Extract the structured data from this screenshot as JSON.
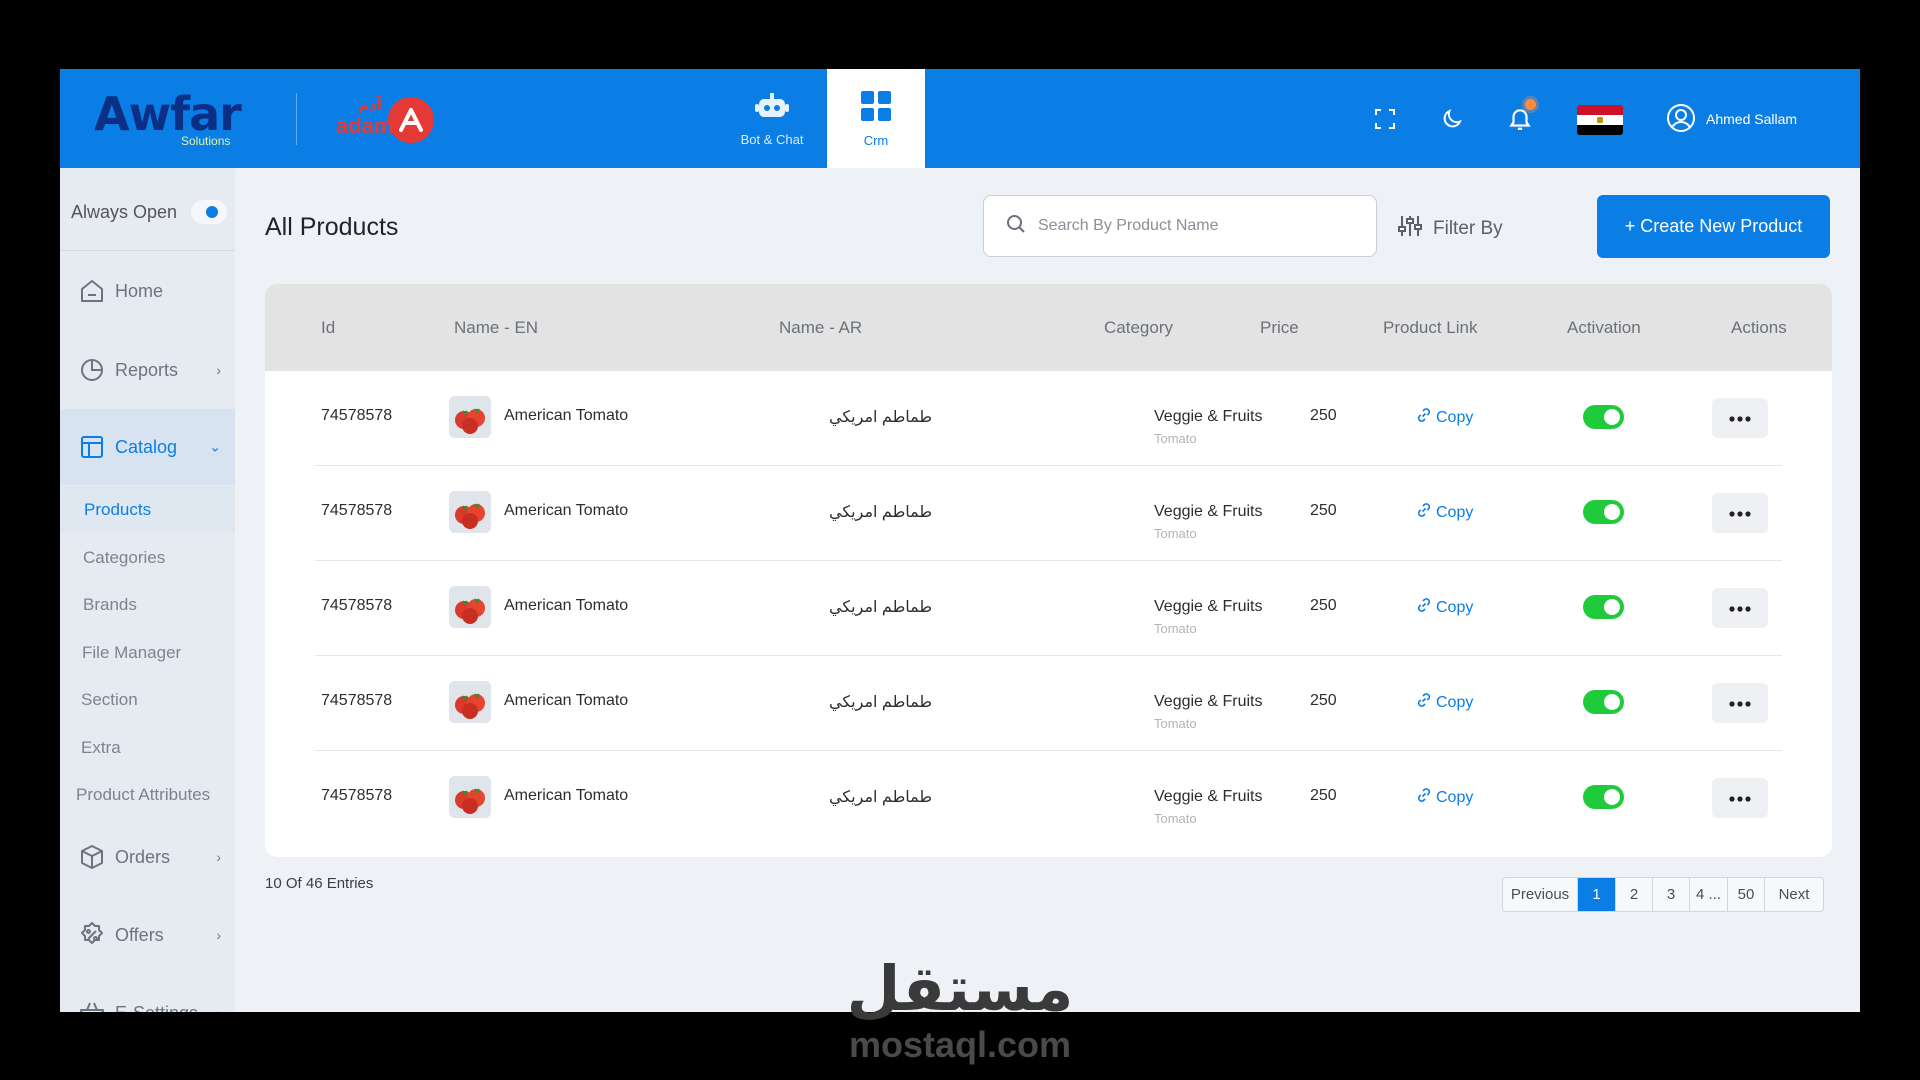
{
  "header": {
    "brand_name": "Awfar",
    "brand_sub": "Solutions",
    "partner_ar": "آدم",
    "partner_en": "adam",
    "tabs": [
      {
        "label": "Bot & Chat",
        "icon": "robot-icon"
      },
      {
        "label": "Crm",
        "icon": "grid-icon",
        "active": true
      }
    ],
    "user_name": "Ahmed Sallam",
    "accent": "#0b7ee6"
  },
  "sidebar": {
    "always_open_label": "Always Open",
    "items": [
      {
        "label": "Home",
        "icon": "home-icon"
      },
      {
        "label": "Reports",
        "icon": "pie-chart-icon"
      },
      {
        "label": "Catalog",
        "icon": "layout-icon",
        "active": true
      },
      {
        "label": "Orders",
        "icon": "box-icon"
      },
      {
        "label": "Offers",
        "icon": "discount-icon"
      },
      {
        "label": "E-Settings",
        "icon": "basket-icon"
      }
    ],
    "catalog_sub": [
      "Products",
      "Categories",
      "Brands",
      "File Manager",
      "Section",
      "Extra",
      "Product Attributes"
    ]
  },
  "main": {
    "title": "All Products",
    "search_placeholder": "Search By Product Name",
    "filter_label": "Filter By",
    "create_label": "+ Create New Product",
    "columns": [
      "Id",
      "Name - EN",
      "Name - AR",
      "Category",
      "Price",
      "Product Link",
      "Activation",
      "Actions"
    ],
    "rows": [
      {
        "id": "74578578",
        "name_en": "American Tomato",
        "name_ar": "طماطم امريكي",
        "category": "Veggie & Fruits",
        "subcategory": "Tomato",
        "price": "250",
        "link_label": "Copy",
        "active": true
      },
      {
        "id": "74578578",
        "name_en": "American Tomato",
        "name_ar": "طماطم امريكي",
        "category": "Veggie & Fruits",
        "subcategory": "Tomato",
        "price": "250",
        "link_label": "Copy",
        "active": true
      },
      {
        "id": "74578578",
        "name_en": "American Tomato",
        "name_ar": "طماطم امريكي",
        "category": "Veggie & Fruits",
        "subcategory": "Tomato",
        "price": "250",
        "link_label": "Copy",
        "active": true
      },
      {
        "id": "74578578",
        "name_en": "American Tomato",
        "name_ar": "طماطم امريكي",
        "category": "Veggie & Fruits",
        "subcategory": "Tomato",
        "price": "250",
        "link_label": "Copy",
        "active": true
      },
      {
        "id": "74578578",
        "name_en": "American Tomato",
        "name_ar": "طماطم امريكي",
        "category": "Veggie & Fruits",
        "subcategory": "Tomato",
        "price": "250",
        "link_label": "Copy",
        "active": true
      }
    ],
    "entries_text": "10 Of 46 Entries",
    "pagination": {
      "previous": "Previous",
      "pages": [
        "1",
        "2",
        "3",
        "4 ...",
        "50"
      ],
      "current": "1",
      "next": "Next"
    }
  },
  "watermark": {
    "ar": "مستقل",
    "en": "mostaql.com"
  }
}
